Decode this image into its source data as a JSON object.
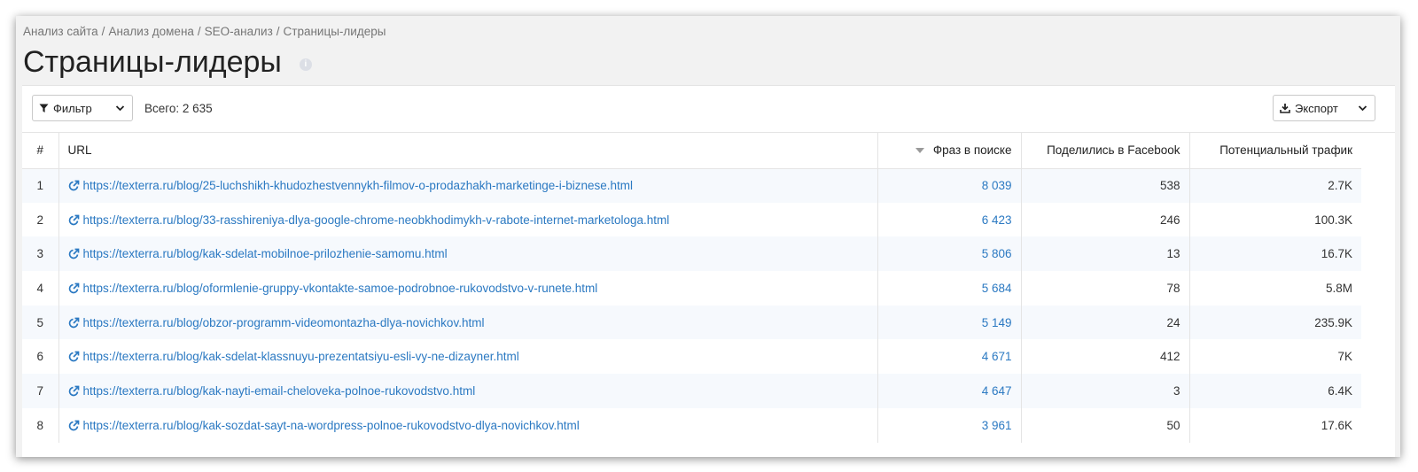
{
  "breadcrumb": [
    "Анализ сайта",
    "Анализ домена",
    "SEO-анализ",
    "Страницы-лидеры"
  ],
  "page_title": "Страницы-лидеры",
  "info_icon_label": "i",
  "toolbar": {
    "filter_label": "Фильтр",
    "total_label": "Всего: 2 635",
    "export_label": "Экспорт"
  },
  "table": {
    "columns": [
      "#",
      "URL",
      "Фраз в поиске",
      "Поделились в Facebook",
      "Потенциальный трафик"
    ],
    "rows": [
      {
        "num": "1",
        "url": "https://texterra.ru/blog/25-luchshikh-khudozhestvennykh-filmov-o-prodazhakh-marketinge-i-biznese.html",
        "phrases": "8 039",
        "facebook": "538",
        "traffic": "2.7K"
      },
      {
        "num": "2",
        "url": "https://texterra.ru/blog/33-rasshireniya-dlya-google-chrome-neobkhodimykh-v-rabote-internet-marketologa.html",
        "phrases": "6 423",
        "facebook": "246",
        "traffic": "100.3K"
      },
      {
        "num": "3",
        "url": "https://texterra.ru/blog/kak-sdelat-mobilnoe-prilozhenie-samomu.html",
        "phrases": "5 806",
        "facebook": "13",
        "traffic": "16.7K"
      },
      {
        "num": "4",
        "url": "https://texterra.ru/blog/oformlenie-gruppy-vkontakte-samoe-podrobnoe-rukovodstvo-v-runete.html",
        "phrases": "5 684",
        "facebook": "78",
        "traffic": "5.8M"
      },
      {
        "num": "5",
        "url": "https://texterra.ru/blog/obzor-programm-videomontazha-dlya-novichkov.html",
        "phrases": "5 149",
        "facebook": "24",
        "traffic": "235.9K"
      },
      {
        "num": "6",
        "url": "https://texterra.ru/blog/kak-sdelat-klassnuyu-prezentatsiyu-esli-vy-ne-dizayner.html",
        "phrases": "4 671",
        "facebook": "412",
        "traffic": "7K"
      },
      {
        "num": "7",
        "url": "https://texterra.ru/blog/kak-nayti-email-cheloveka-polnoe-rukovodstvo.html",
        "phrases": "4 647",
        "facebook": "3",
        "traffic": "6.4K"
      },
      {
        "num": "8",
        "url": "https://texterra.ru/blog/kak-sozdat-sayt-na-wordpress-polnoe-rukovodstvo-dlya-novichkov.html",
        "phrases": "3 961",
        "facebook": "50",
        "traffic": "17.6K"
      }
    ]
  },
  "icons": {
    "filter": "filter-icon",
    "export": "download-icon",
    "dropdown": "chevron-down-icon",
    "external_link": "external-link-icon",
    "sort": "sort-desc-icon",
    "info": "info-icon"
  },
  "colors": {
    "link": "#2b79c2",
    "row_stripe": "#f6f9fd",
    "background": "#f2f2f2"
  }
}
